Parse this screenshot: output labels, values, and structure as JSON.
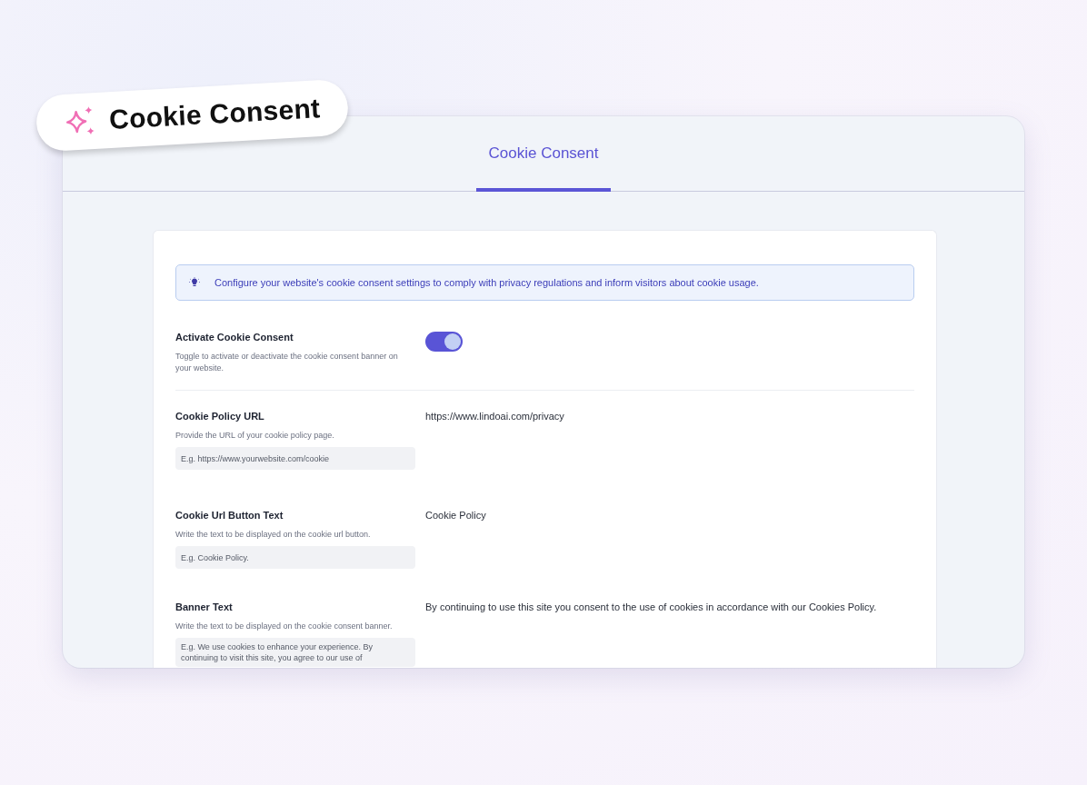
{
  "badge": {
    "title": "Cookie Consent"
  },
  "tabs": [
    {
      "label": "Cookie Consent",
      "selected": true
    }
  ],
  "notice": {
    "text": "Configure your website's cookie consent settings to comply with privacy regulations and inform visitors about cookie usage."
  },
  "settings": [
    {
      "kind": "toggle",
      "label": "Activate Cookie Consent",
      "description": "Toggle to activate or deactivate the cookie consent banner on your website.",
      "on": true
    },
    {
      "kind": "field",
      "label": "Cookie Policy URL",
      "description": "Provide the URL of your cookie policy page.",
      "placeholder": "E.g. https://www.yourwebsite.com/cookie",
      "value": "https://www.lindoai.com/privacy"
    },
    {
      "kind": "field",
      "label": "Cookie Url Button Text",
      "description": "Write the text to be displayed on the cookie url button.",
      "placeholder": "E.g. Cookie Policy.",
      "value": "Cookie Policy"
    },
    {
      "kind": "textarea",
      "label": "Banner Text",
      "description": "Write the text to be displayed on the cookie consent banner.",
      "placeholder": "E.g. We use cookies to enhance your experience. By continuing to visit this site, you agree to our use of",
      "value": "By continuing to use this site you consent to the use of cookies in accordance with our Cookies Policy."
    }
  ]
}
